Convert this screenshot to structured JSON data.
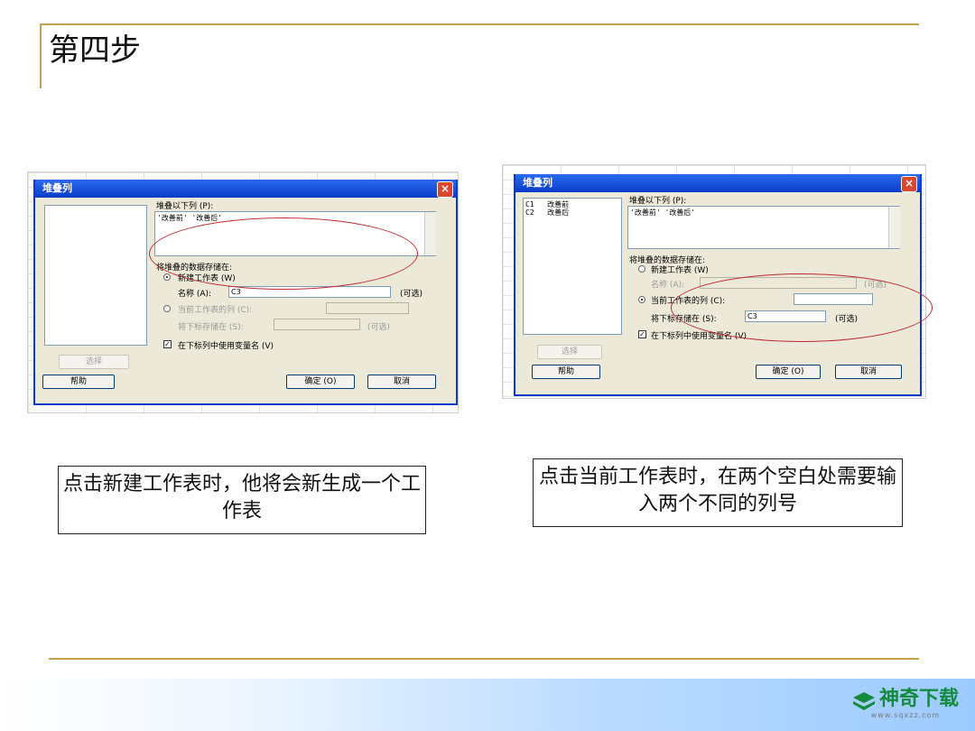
{
  "slide": {
    "title": "第四步"
  },
  "left_dialog": {
    "title": "堆叠列",
    "stack_label": "堆叠以下列 (P):",
    "stack_value": "'改善前' '改善后'",
    "store_label": "将堆叠的数据存储在:",
    "new_sheet_label": "新建工作表 (W)",
    "name_label": "名称 (A):",
    "name_value": "C3",
    "optional_1": "(可选)",
    "current_sheet_label": "当前工作表的列 (C):",
    "subscript_label": "将下标存储在 (S):",
    "optional_2": "(可选)",
    "use_var_names": "在下标列中使用变量名 (V)",
    "select_button": "选择",
    "help_button": "帮助",
    "ok_button": "确定 (O)",
    "cancel_button": "取消"
  },
  "right_dialog": {
    "title": "堆叠列",
    "list_items": [
      {
        "col": "C1",
        "name": "改善前"
      },
      {
        "col": "C2",
        "name": "改善后"
      }
    ],
    "stack_label": "堆叠以下列 (P):",
    "stack_value": "'改善前' '改善后'",
    "store_label": "将堆叠的数据存储在:",
    "new_sheet_label": "新建工作表 (W)",
    "name_label": "名称 (A):",
    "optional_1": "(可选)",
    "current_sheet_label": "当前工作表的列 (C):",
    "subscript_label": "将下标存储在 (S):",
    "subscript_value": "C3",
    "optional_2": "(可选)",
    "use_var_names": "在下标列中使用变量名 (V)",
    "select_button": "选择",
    "help_button": "帮助",
    "ok_button": "确定 (O)",
    "cancel_button": "取消"
  },
  "captions": {
    "left": "点击新建工作表时，他将会新生成一个工作表",
    "right": "点击当前工作表时，在两个空白处需要输入两个不同的列号"
  },
  "footer": {
    "logo_text": "神奇下载",
    "logo_url": "www.sqxzz.com"
  },
  "colors": {
    "accent_line": "#c8a24a",
    "highlight_ellipse": "#c0282c",
    "logo_green": "#138a3c"
  }
}
